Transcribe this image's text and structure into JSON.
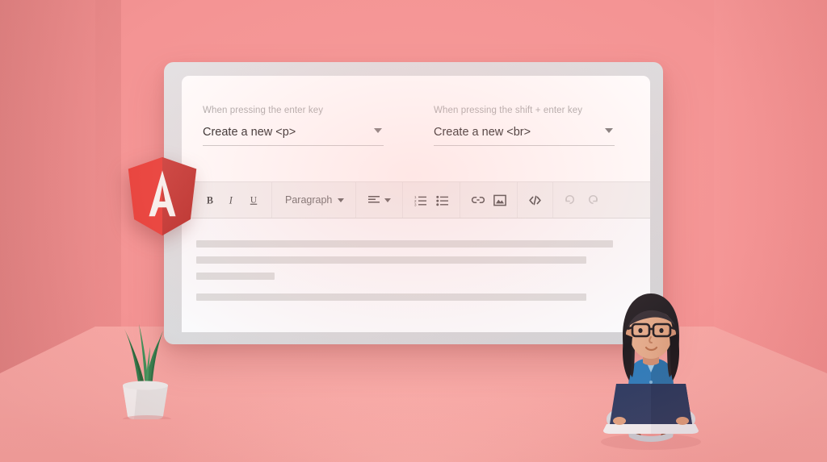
{
  "scene": {
    "background_wall_color": "#f49494",
    "side_wall_color": "#e08282",
    "floor_color": "#f7a7a4"
  },
  "monitor": {
    "frame_color": "#dcdcde",
    "screen_color": "#ffffff"
  },
  "fields": [
    {
      "label": "When pressing the enter key",
      "value": "Create a new <p>",
      "caret_icon": "chevron-down-icon"
    },
    {
      "label": "When pressing the shift + enter key",
      "value": "Create a new <br>",
      "caret_icon": "chevron-down-icon"
    }
  ],
  "toolbar": {
    "groups": [
      {
        "name": "text-style",
        "items": [
          {
            "name": "bold-button",
            "icon": "bold-icon",
            "label": "B",
            "disabled": false
          },
          {
            "name": "italic-button",
            "icon": "italic-icon",
            "label": "I",
            "disabled": false
          },
          {
            "name": "underline-button",
            "icon": "underline-icon",
            "label": "U",
            "disabled": false
          }
        ]
      },
      {
        "name": "block-format",
        "items": [
          {
            "name": "paragraph-dropdown",
            "icon": "chevron-down-icon",
            "label": "Paragraph",
            "disabled": false
          }
        ]
      },
      {
        "name": "alignment",
        "items": [
          {
            "name": "align-dropdown",
            "icon": "align-left-icon",
            "label": "",
            "disabled": false
          }
        ]
      },
      {
        "name": "lists",
        "items": [
          {
            "name": "ordered-list-button",
            "icon": "ordered-list-icon",
            "label": "",
            "disabled": false
          },
          {
            "name": "unordered-list-button",
            "icon": "unordered-list-icon",
            "label": "",
            "disabled": false
          }
        ]
      },
      {
        "name": "insert",
        "items": [
          {
            "name": "link-button",
            "icon": "link-icon",
            "label": "",
            "disabled": false
          },
          {
            "name": "image-button",
            "icon": "image-icon",
            "label": "",
            "disabled": false
          }
        ]
      },
      {
        "name": "code",
        "items": [
          {
            "name": "code-view-button",
            "icon": "code-icon",
            "label": "",
            "disabled": false
          }
        ]
      },
      {
        "name": "history",
        "items": [
          {
            "name": "undo-button",
            "icon": "undo-icon",
            "label": "",
            "disabled": true
          },
          {
            "name": "redo-button",
            "icon": "redo-icon",
            "label": "",
            "disabled": true
          }
        ]
      }
    ],
    "paragraph_label": "Paragraph"
  },
  "document": {
    "placeholder_line_widths": [
      "100%",
      "96%",
      "22%",
      "95%"
    ],
    "line_color": "#dcdcdc"
  },
  "decorations": {
    "angular_logo": {
      "name": "angular-logo",
      "letter": "A",
      "light_red": "#e8403a",
      "dark_red": "#c32c28"
    },
    "plant": {
      "name": "potted-plant",
      "pot_color": "#e2e2e2",
      "leaf_color": "#2f7a4b"
    },
    "person": {
      "name": "person-with-laptop-illustration",
      "hair_color": "#272226",
      "shirt_color": "#2f7dbb",
      "laptop_color": "#2c3c63",
      "skin_color": "#e0a184"
    }
  }
}
